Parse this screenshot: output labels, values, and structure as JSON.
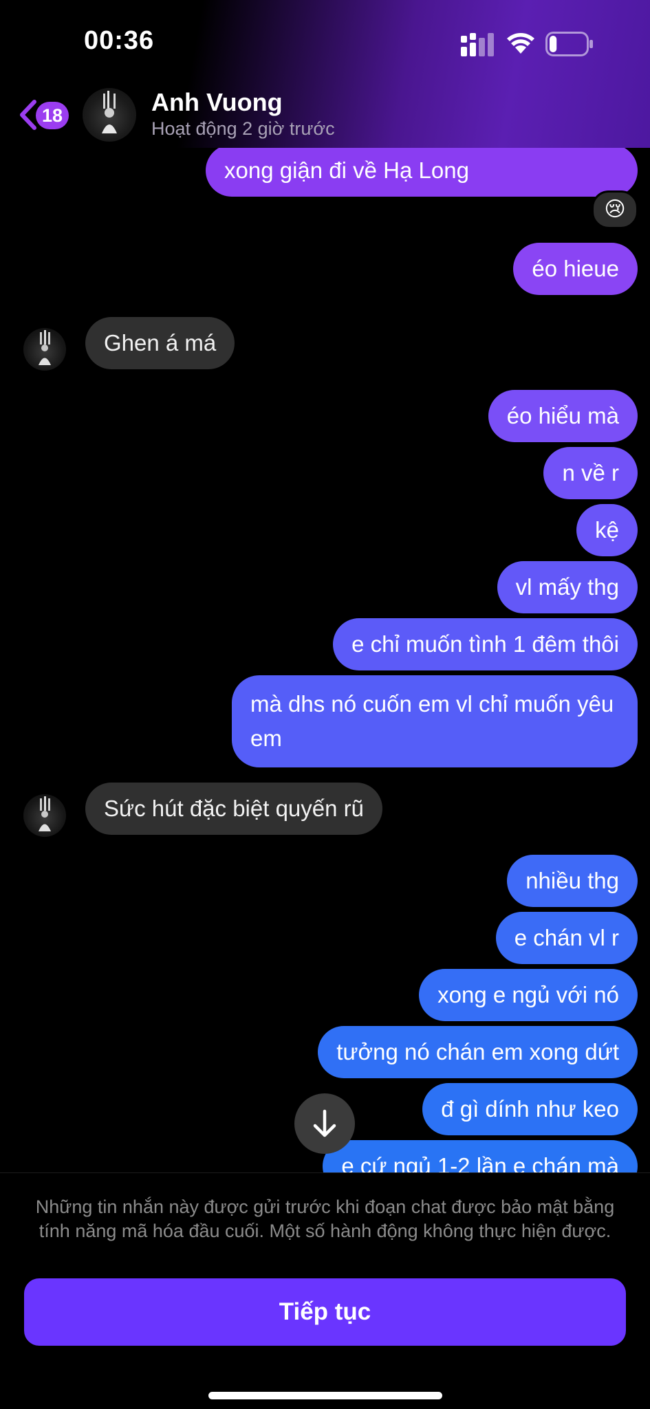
{
  "status_bar": {
    "time": "00:36",
    "battery_level": 0.2
  },
  "header": {
    "badge_count": "18",
    "contact_name": "Anh Vuong",
    "contact_status": "Hoạt động 2 giờ trước"
  },
  "messages": [
    {
      "direction": "outgoing",
      "text": "xong giận đi về Hạ Long",
      "color": "#8a3df2",
      "reaction": "😢"
    },
    {
      "direction": "outgoing",
      "text": "éo hieue",
      "color": "#8a45f4"
    },
    {
      "direction": "incoming",
      "text": "Ghen á má"
    },
    {
      "direction": "outgoing",
      "text": "éo hiểu mà",
      "color": "#7a4ff7"
    },
    {
      "direction": "outgoing",
      "text": "n về r",
      "color": "#7252f8"
    },
    {
      "direction": "outgoing",
      "text": "kệ",
      "color": "#6a55f8"
    },
    {
      "direction": "outgoing",
      "text": "vl mấy thg",
      "color": "#6358f8"
    },
    {
      "direction": "outgoing",
      "text": "e chỉ muốn tình 1 đêm thôi",
      "color": "#5c5bf8"
    },
    {
      "direction": "outgoing",
      "text": "mà dhs nó cuốn em vl chỉ muốn yêu em",
      "color": "#555ef8"
    },
    {
      "direction": "incoming",
      "text": "Sức hút đặc biệt quyến rũ"
    },
    {
      "direction": "outgoing",
      "text": "nhiều thg",
      "color": "#3f6af7"
    },
    {
      "direction": "outgoing",
      "text": "e chán vl r",
      "color": "#3a6cf6"
    },
    {
      "direction": "outgoing",
      "text": "xong e ngủ với nó",
      "color": "#356ef6"
    },
    {
      "direction": "outgoing",
      "text": "tưởng nó chán em xong dứt",
      "color": "#3070f5"
    },
    {
      "direction": "outgoing",
      "text": "đ gì dính như keo",
      "color": "#2c72f5"
    },
    {
      "direction": "outgoing",
      "text": "e cứ ngủ 1-2 lần e chán mà",
      "color": "#2974f4"
    }
  ],
  "footer": {
    "notice": "Những tin nhắn này được gửi trước khi đoạn chat được bảo mật bằng tính năng mã hóa đầu cuối. Một số hành động không thực hiện được.",
    "continue_label": "Tiếp tục"
  },
  "colors": {
    "accent": "#6a35ff",
    "badge": "#9b3df0",
    "incoming_bubble": "#303030"
  }
}
